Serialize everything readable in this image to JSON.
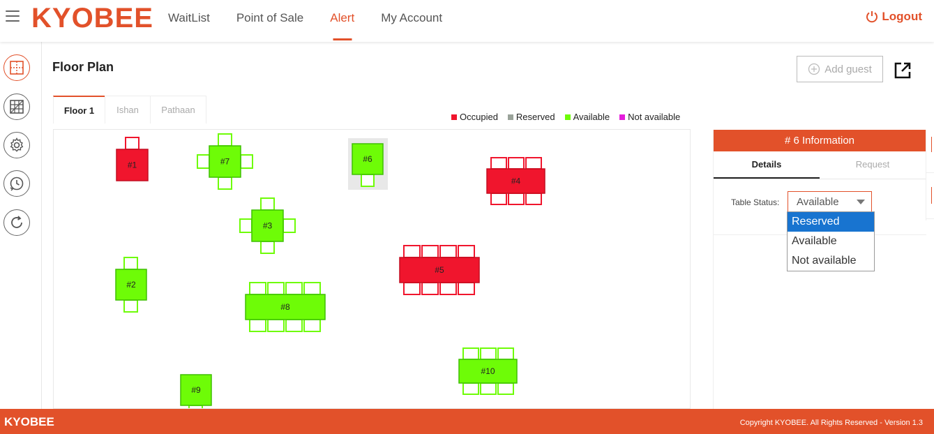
{
  "app": {
    "brand": "KYOBEE"
  },
  "nav": {
    "items": [
      {
        "label": "WaitList",
        "active": false
      },
      {
        "label": "Point of Sale",
        "active": false
      },
      {
        "label": "Alert",
        "active": true
      },
      {
        "label": "My Account",
        "active": false
      }
    ],
    "logout_label": "Logout"
  },
  "sidebar": {
    "items": [
      {
        "icon": "floor-plan-icon",
        "active": true
      },
      {
        "icon": "floor-grid-icon",
        "active": false
      },
      {
        "icon": "gear-icon",
        "active": false
      },
      {
        "icon": "history-clock-icon",
        "active": false
      },
      {
        "icon": "refresh-icon",
        "active": false
      }
    ]
  },
  "page": {
    "title": "Floor Plan",
    "add_guest_label": "Add guest"
  },
  "floor_tabs": [
    {
      "label": "Floor 1",
      "active": true
    },
    {
      "label": "Ishan",
      "active": false
    },
    {
      "label": "Pathaan",
      "active": false
    }
  ],
  "legend": [
    {
      "label": "Occupied",
      "color": "#f0152d"
    },
    {
      "label": "Reserved",
      "color": "#9aa39a"
    },
    {
      "label": "Available",
      "color": "#6efc07"
    },
    {
      "label": "Not available",
      "color": "#e41ddb"
    }
  ],
  "tables": [
    {
      "label": "#1",
      "status": "Occupied"
    },
    {
      "label": "#7",
      "status": "Available"
    },
    {
      "label": "#6",
      "status": "Available",
      "selected": true
    },
    {
      "label": "#4",
      "status": "Occupied"
    },
    {
      "label": "#3",
      "status": "Available"
    },
    {
      "label": "#2",
      "status": "Available"
    },
    {
      "label": "#5",
      "status": "Occupied"
    },
    {
      "label": "#8",
      "status": "Available"
    },
    {
      "label": "#10",
      "status": "Available"
    },
    {
      "label": "#9",
      "status": "Available"
    }
  ],
  "info": {
    "header": "# 6 Information",
    "tabs": [
      {
        "label": "Details",
        "active": true
      },
      {
        "label": "Request",
        "active": false
      }
    ],
    "status_label": "Table Status:",
    "status_value": "Available",
    "status_options": [
      {
        "label": "Reserved",
        "highlighted": true
      },
      {
        "label": "Available",
        "highlighted": false
      },
      {
        "label": "Not available",
        "highlighted": false
      }
    ]
  },
  "footer": {
    "brand": "KYOBEE",
    "copyright": "Copyright KYOBEE. All Rights Reserved - Version 1.3"
  },
  "colors": {
    "accent": "#e2512a",
    "occupied": "#f0152d",
    "available": "#6efc07",
    "select_highlight": "#1874d0"
  }
}
